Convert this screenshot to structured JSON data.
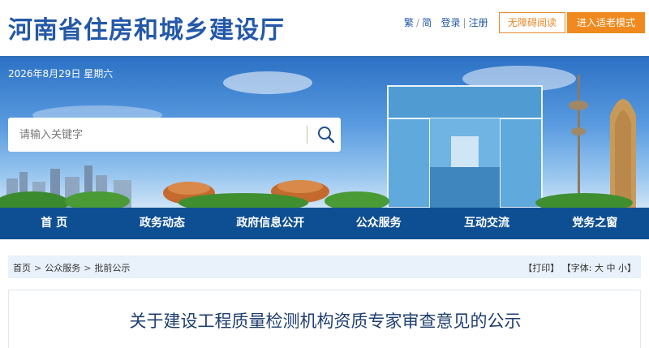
{
  "header": {
    "site_title": "河南省住房和城乡建设厅",
    "link_traditional": "繁",
    "link_sep": "/",
    "link_simplified": "简",
    "link_login": "登录",
    "link_divider": "|",
    "link_register": "注册",
    "accessibility_button": "无障碍阅读",
    "elder_mode_button": "进入适老模式"
  },
  "banner": {
    "date": "2026年8月29日 星期六"
  },
  "search": {
    "placeholder": "请输入关键字",
    "icon": "search-icon"
  },
  "nav": {
    "items": [
      {
        "label": "首 页"
      },
      {
        "label": "政务动态"
      },
      {
        "label": "政府信息公开"
      },
      {
        "label": "公众服务"
      },
      {
        "label": "互动交流"
      },
      {
        "label": "党务之窗"
      }
    ]
  },
  "breadcrumb": {
    "items": [
      "首页",
      "公众服务",
      "批前公示"
    ],
    "separator": ">"
  },
  "tools": {
    "print": "【打印】",
    "font_prefix": "【字体:",
    "font_large": "大",
    "font_medium": "中",
    "font_small": "小",
    "font_suffix": "】"
  },
  "article": {
    "title": "关于建设工程质量检测机构资质专家审查意见的公示"
  },
  "colors": {
    "brand_blue": "#2458a8",
    "nav_blue": "#0e4f94",
    "accent_orange": "#f08a1e"
  }
}
